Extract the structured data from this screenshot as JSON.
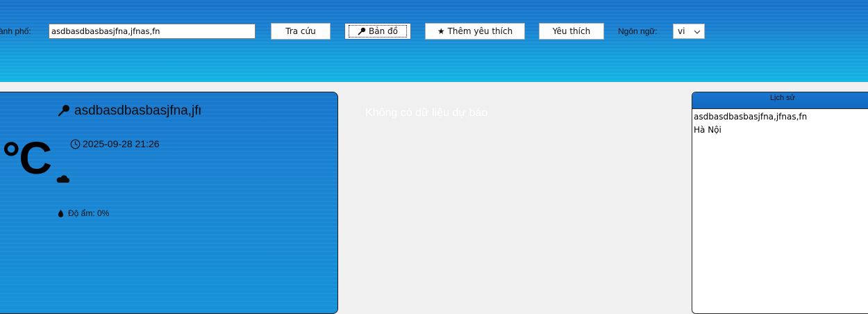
{
  "toolbar": {
    "city_label": "ành phố:",
    "city_value": "asdbasdbasbasjfna,jfnas,fn",
    "search_label": "Tra cứu",
    "map_label": "Bản đồ",
    "add_favorite_label": "Thêm yêu thích",
    "favorites_label": "Yêu thích",
    "language_label": "Ngôn ngữ:",
    "language_value": "vi"
  },
  "current": {
    "city": "asdbasdbasbasjfna,jfnas,fn",
    "datetime": "2025-09-28 21:26",
    "temperature": "°C",
    "humidity": "Độ ẩm: 0%"
  },
  "forecast": {
    "empty_message": "Không có dữ liệu dự báo"
  },
  "history": {
    "title": "Lịch sử",
    "items": [
      "asdbasdbasbasjfna,jfnas,fn",
      "Hà Nội"
    ]
  },
  "colors": {
    "toolbar_top": "#1472c9",
    "toolbar_bottom": "#12b3e3",
    "card": "#1a83d2",
    "background": "#f0f0f0"
  },
  "icons": {
    "map": "pin-icon",
    "add_favorite": "star-icon",
    "datetime": "clock-icon",
    "humidity": "droplet-icon",
    "condition": "cloud-icon",
    "language": "chevron-down-icon"
  }
}
